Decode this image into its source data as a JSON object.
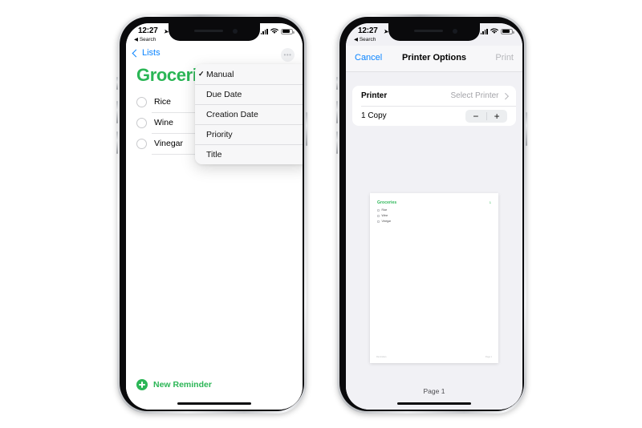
{
  "phones": {
    "left": {
      "status_bar": {
        "time": "12:27",
        "location_arrow_icon": "location-arrow-icon",
        "back_label": "Search",
        "back_icon": "triangle-left-icon",
        "signal_icon": "cellular-signal-icon",
        "wifi_icon": "wifi-icon",
        "battery_icon": "battery-icon"
      },
      "app": "Reminders",
      "nav": {
        "back_label": "Lists",
        "back_icon": "chevron-left-icon",
        "more_icon": "more-ellipsis-icon",
        "more_label": "•••"
      },
      "list": {
        "title": "Groceries",
        "title_color": "#2BB656",
        "items": [
          {
            "label": "Rice",
            "checked": false
          },
          {
            "label": "Wine",
            "checked": false
          },
          {
            "label": "Vinegar",
            "checked": false
          }
        ]
      },
      "new_reminder": {
        "label": "New Reminder",
        "icon": "plus-circle-icon",
        "color": "#2BB656"
      },
      "sort_menu": {
        "check_glyph": "✓",
        "items": [
          {
            "label": "Manual",
            "selected": true
          },
          {
            "label": "Due Date",
            "selected": false
          },
          {
            "label": "Creation Date",
            "selected": false
          },
          {
            "label": "Priority",
            "selected": false
          },
          {
            "label": "Title",
            "selected": false
          }
        ]
      }
    },
    "right": {
      "status_bar": {
        "time": "12:27",
        "location_arrow_icon": "location-arrow-icon",
        "back_label": "Search",
        "back_icon": "triangle-left-icon",
        "signal_icon": "cellular-signal-icon",
        "wifi_icon": "wifi-icon",
        "battery_icon": "battery-icon"
      },
      "app": "Printer Options",
      "nav": {
        "cancel_label": "Cancel",
        "title": "Printer Options",
        "print_label": "Print"
      },
      "options": {
        "printer_row": {
          "label": "Printer",
          "value": "Select Printer",
          "chevron_icon": "chevron-right-icon"
        },
        "copies_row": {
          "label": "1 Copy",
          "minus_label": "−",
          "plus_label": "+",
          "minus_icon": "minus-icon",
          "plus_icon": "plus-icon"
        }
      },
      "preview": {
        "caption": "Page 1",
        "document": {
          "heading": "Groceries",
          "heading_color": "#2BB656",
          "page_number": "1",
          "items": [
            "Rice",
            "Wine",
            "Vinegar"
          ],
          "footer_left": "Reminders",
          "footer_right": "Page 1"
        }
      }
    }
  }
}
